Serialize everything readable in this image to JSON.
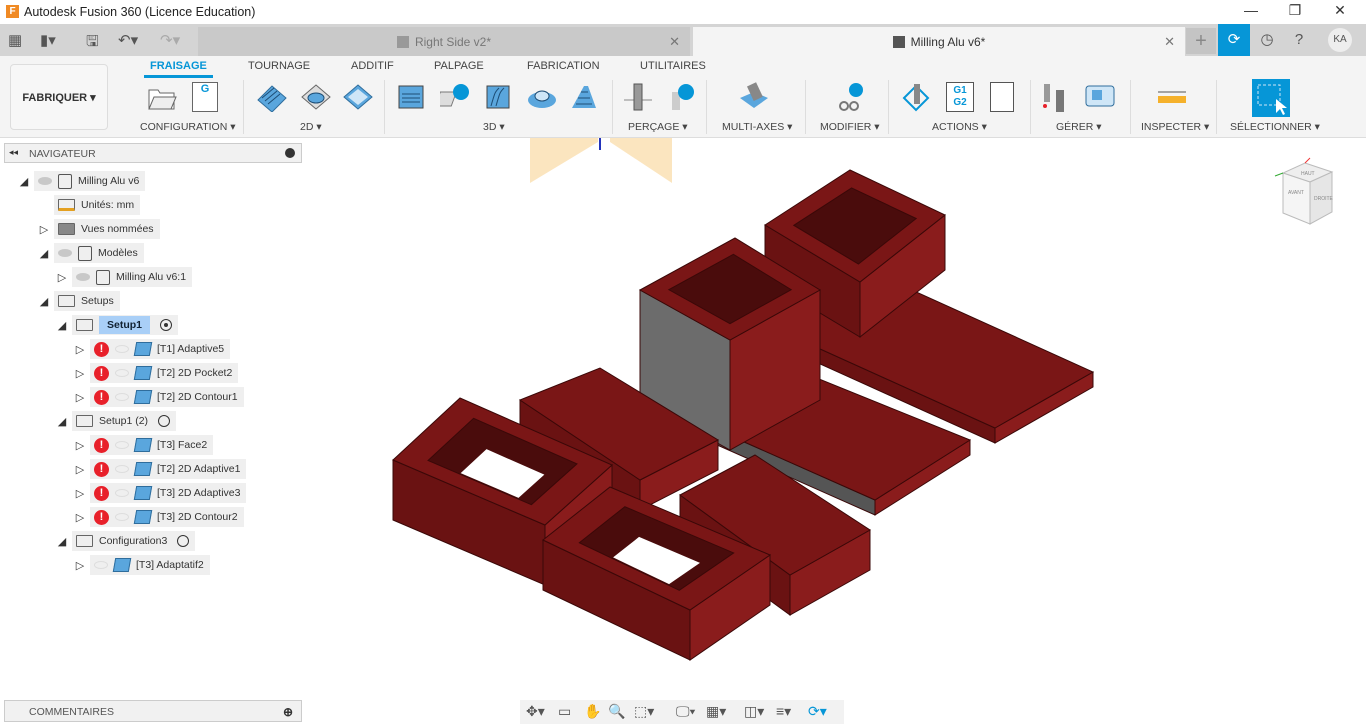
{
  "app": {
    "title": "Autodesk Fusion 360 (Licence Education)",
    "logo_letter": "F"
  },
  "window": {
    "minimize": "—",
    "maximize": "❐",
    "close": "✕"
  },
  "doc_tabs": [
    {
      "label": "Right Side v2*",
      "active": false
    },
    {
      "label": "Milling Alu v6*",
      "active": true
    }
  ],
  "user": {
    "initials": "KA"
  },
  "ribbon": {
    "workspace": "FABRIQUER ▾",
    "tabs": [
      "FRAISAGE",
      "TOURNAGE",
      "ADDITIF",
      "PALPAGE",
      "FABRICATION",
      "UTILITAIRES"
    ],
    "active_tab": "FRAISAGE",
    "groups": [
      "CONFIGURATION ▾",
      "2D ▾",
      "3D ▾",
      "PERÇAGE ▾",
      "MULTI-AXES ▾",
      "MODIFIER ▾",
      "ACTIONS ▾",
      "GÉRER ▾",
      "INSPECTER ▾",
      "SÉLECTIONNER ▾"
    ],
    "gcode_icon_text": "G",
    "g1g2_text": "G1\nG2"
  },
  "navigator": {
    "title": "NAVIGATEUR",
    "tree": [
      {
        "level": 0,
        "expand": "open",
        "eye": true,
        "icon": "component",
        "label": "Milling Alu v6"
      },
      {
        "level": 1,
        "expand": "none",
        "icon": "units",
        "label": "Unités: mm"
      },
      {
        "level": 1,
        "expand": "closed",
        "icon": "folder-solid",
        "label": "Vues nommées"
      },
      {
        "level": 1,
        "expand": "open",
        "eye": true,
        "icon": "component",
        "label": "Modèles"
      },
      {
        "level": 2,
        "expand": "closed",
        "eye": true,
        "icon": "component",
        "label": "Milling Alu v6:1"
      },
      {
        "level": 1,
        "expand": "open",
        "icon": "folder-open",
        "label": "Setups"
      },
      {
        "level": 2,
        "expand": "open",
        "icon": "folder-open",
        "label": "Setup1",
        "selected": true,
        "radio": "on"
      },
      {
        "level": 3,
        "expand": "closed",
        "error": true,
        "icon": "op",
        "label": "[T1] Adaptive5"
      },
      {
        "level": 3,
        "expand": "closed",
        "error": true,
        "icon": "op",
        "label": "[T2] 2D Pocket2"
      },
      {
        "level": 3,
        "expand": "closed",
        "error": true,
        "icon": "op",
        "label": "[T2] 2D Contour1"
      },
      {
        "level": 2,
        "expand": "open",
        "icon": "folder-open",
        "label": "Setup1 (2)",
        "radio": "off"
      },
      {
        "level": 3,
        "expand": "closed",
        "error": true,
        "icon": "op",
        "label": "[T3] Face2"
      },
      {
        "level": 3,
        "expand": "closed",
        "error": true,
        "icon": "op",
        "label": "[T2] 2D Adaptive1"
      },
      {
        "level": 3,
        "expand": "closed",
        "error": true,
        "icon": "op",
        "label": "[T3] 2D Adaptive3"
      },
      {
        "level": 3,
        "expand": "closed",
        "error": true,
        "icon": "op",
        "label": "[T3] 2D Contour2"
      },
      {
        "level": 2,
        "expand": "open",
        "icon": "folder-open",
        "label": "Configuration3",
        "radio": "off"
      },
      {
        "level": 3,
        "expand": "closed",
        "error": false,
        "icon": "op",
        "label": "[T3] Adaptatif2"
      }
    ]
  },
  "comments": {
    "title": "COMMENTAIRES"
  },
  "viewcube": {
    "faces": [
      "HAUT",
      "DROITE",
      "AVANT"
    ]
  },
  "colors": {
    "accent": "#0696d7",
    "part": "#7a1616",
    "error": "#e8202a",
    "selection": "#a9cff7"
  }
}
